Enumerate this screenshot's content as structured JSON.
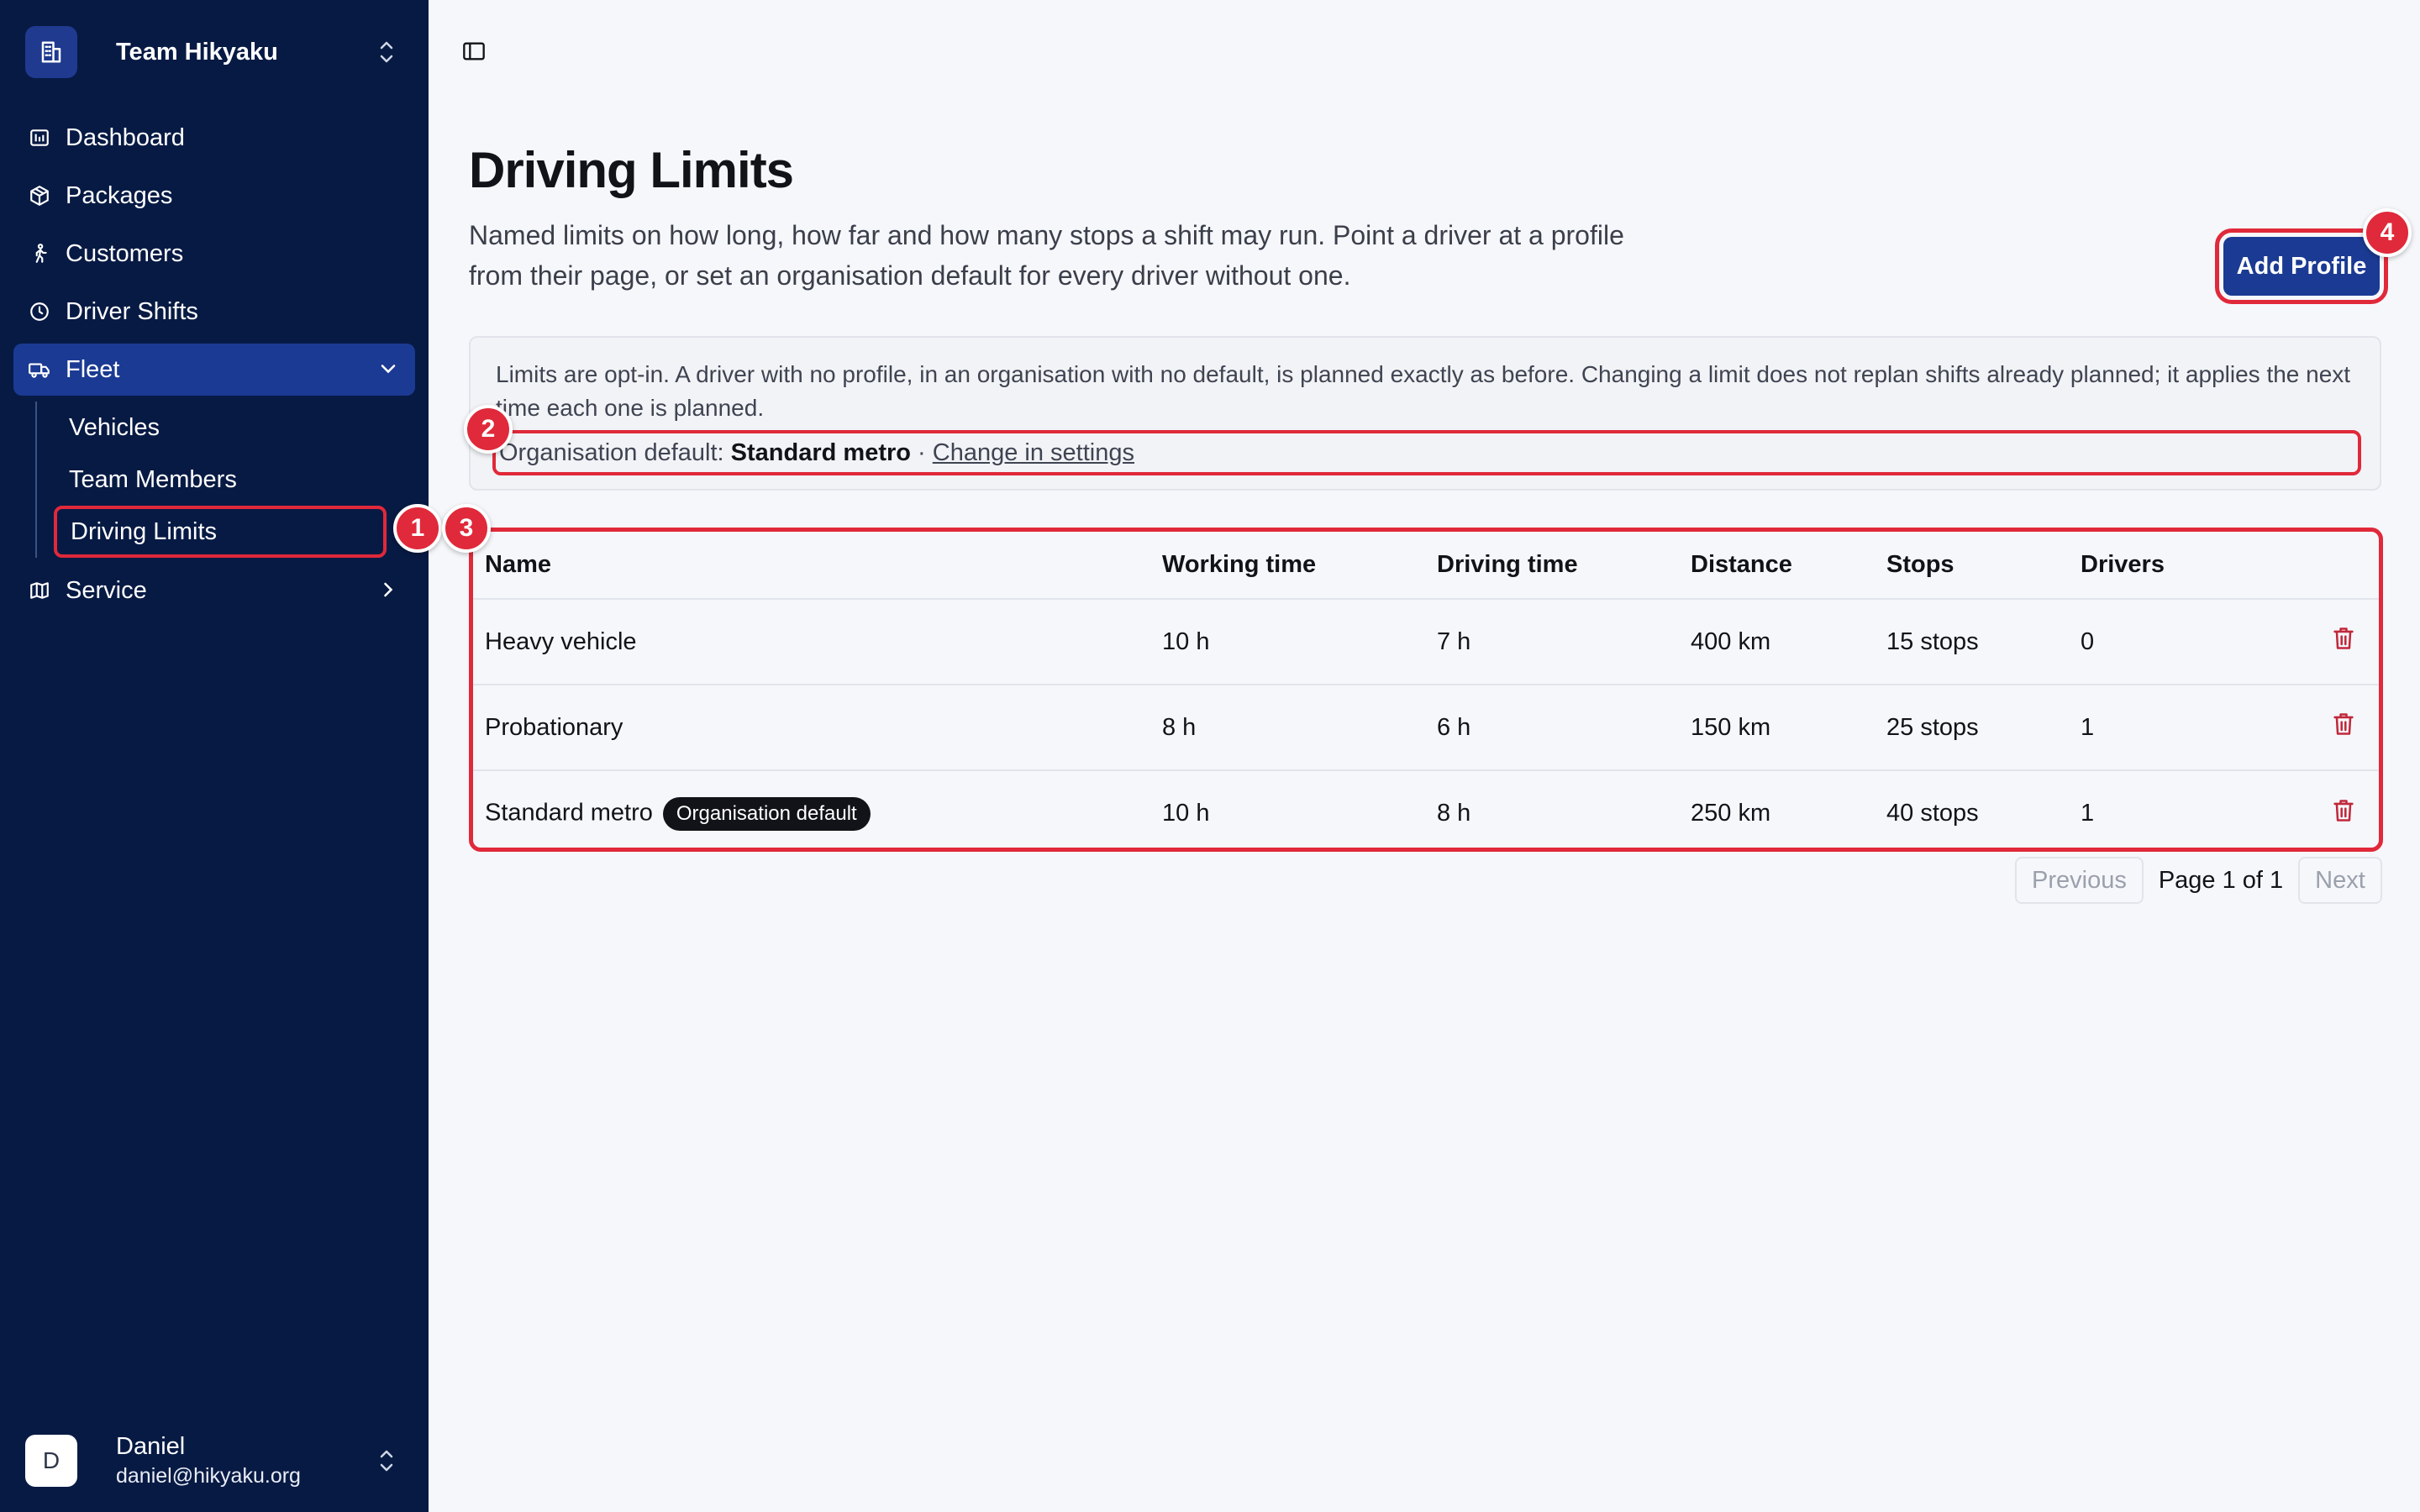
{
  "sidebar": {
    "team_name": "Team Hikyaku",
    "items": {
      "dashboard": "Dashboard",
      "packages": "Packages",
      "customers": "Customers",
      "driver_shifts": "Driver Shifts",
      "fleet": "Fleet",
      "service": "Service"
    },
    "fleet_children": {
      "vehicles": "Vehicles",
      "team_members": "Team Members",
      "driving_limits": "Driving Limits"
    },
    "user": {
      "initial": "D",
      "name": "Daniel",
      "email": "daniel@hikyaku.org"
    }
  },
  "page": {
    "title": "Driving Limits",
    "subtitle_line1": "Named limits on how long, how far and how many stops a shift may run. Point a driver at a profile",
    "subtitle_line2": "from their page, or set an organisation default for every driver without one.",
    "add_button": "Add Profile"
  },
  "notice": {
    "text": "Limits are opt-in. A driver with no profile, in an organisation with no default, is planned exactly as before. Changing a limit does not replan shifts already planned; it applies the next time each one is planned.",
    "default_prefix": "Organisation default: ",
    "default_value": "Standard metro",
    "separator": " · ",
    "change_link": "Change in settings"
  },
  "table": {
    "headers": {
      "name": "Name",
      "working": "Working time",
      "driving": "Driving time",
      "distance": "Distance",
      "stops": "Stops",
      "drivers": "Drivers"
    },
    "rows": [
      {
        "name": "Heavy vehicle",
        "badge": "",
        "working": "10 h",
        "driving": "7 h",
        "distance": "400 km",
        "stops": "15 stops",
        "drivers": "0"
      },
      {
        "name": "Probationary",
        "badge": "",
        "working": "8 h",
        "driving": "6 h",
        "distance": "150 km",
        "stops": "25 stops",
        "drivers": "1"
      },
      {
        "name": "Standard metro",
        "badge": "Organisation default",
        "working": "10 h",
        "driving": "8 h",
        "distance": "250 km",
        "stops": "40 stops",
        "drivers": "1"
      }
    ]
  },
  "pagination": {
    "previous": "Previous",
    "label": "Page 1 of 1",
    "next": "Next"
  },
  "markers": [
    "1",
    "2",
    "3",
    "4"
  ],
  "colors": {
    "sidebar_bg": "#071a44",
    "accent": "#1b3a93",
    "highlight": "#e0293a",
    "trash": "#c0283a"
  }
}
